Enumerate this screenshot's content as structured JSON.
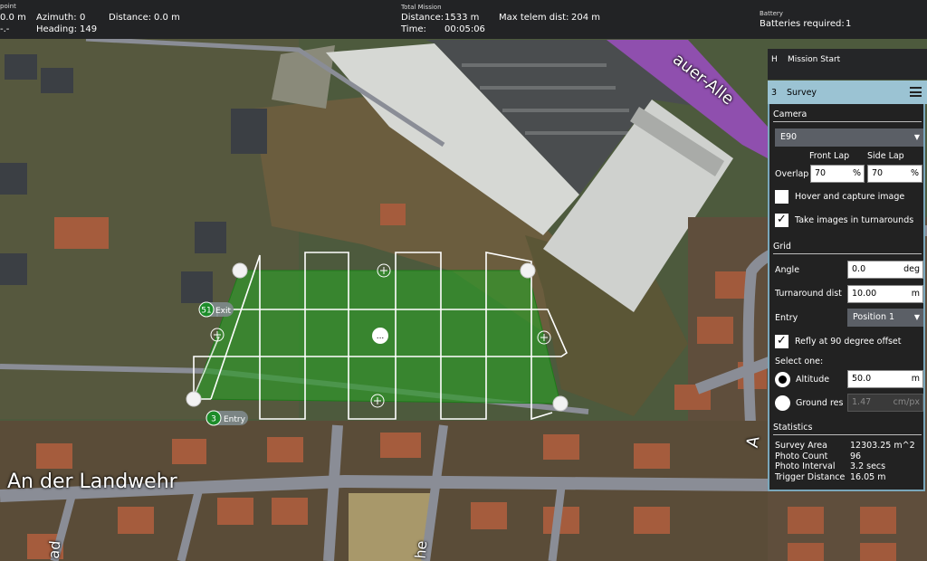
{
  "topbar": {
    "waypoint_header": "point",
    "waypoint_left_value1": "0.0 m",
    "waypoint_left_value2": "-.-",
    "azimuth_label": "Azimuth:",
    "azimuth_value": "0",
    "distance_label": "Distance:",
    "distance_value": "0.0 m",
    "heading_label": "Heading:",
    "heading_value": "149",
    "total_mission_header": "Total Mission",
    "total_distance_label": "Distance:",
    "total_distance_value": "1533 m",
    "time_label": "Time:",
    "time_value": "00:05:06",
    "max_telem_label": "Max telem dist:",
    "max_telem_value": "204 m",
    "battery_header": "Battery",
    "batteries_label": "Batteries required:",
    "batteries_value": "1"
  },
  "map": {
    "street_landwehr": "An der Landwehr",
    "street_top_right": "auer-Alle",
    "street_bottom_right": "A",
    "street_bottom_left": "ad",
    "street_bottom_center": "he",
    "entry_marker": {
      "number": "3",
      "label": "Entry"
    },
    "exit_marker": {
      "number": "51",
      "label": "Exit"
    },
    "center_marker": "..."
  },
  "plan": {
    "mission_start_index": "H",
    "mission_start_label": "Mission Start"
  },
  "survey": {
    "index": "3",
    "title": "Survey",
    "camera_section": "Camera",
    "camera_value": "E90",
    "front_lap_label": "Front Lap",
    "side_lap_label": "Side Lap",
    "overlap_label": "Overlap",
    "front_lap_value": "70",
    "side_lap_value": "70",
    "percent_unit": "%",
    "hover_capture_label": "Hover and capture image",
    "hover_capture_checked": false,
    "turnaround_images_label": "Take images in turnarounds",
    "turnaround_images_checked": true,
    "grid_section": "Grid",
    "angle_label": "Angle",
    "angle_value": "0.0",
    "angle_unit": "deg",
    "turnaround_label": "Turnaround dist",
    "turnaround_value": "10.00",
    "turnaround_unit": "m",
    "entry_label": "Entry",
    "entry_value": "Position 1",
    "refly_label": "Refly at 90 degree offset",
    "refly_checked": true,
    "select_one_label": "Select one:",
    "altitude_label": "Altitude",
    "altitude_value": "50.0",
    "altitude_unit": "m",
    "ground_res_label": "Ground res",
    "ground_res_value": "1.47",
    "ground_res_unit": "cm/px",
    "statistics_section": "Statistics",
    "stats": [
      {
        "label": "Survey Area",
        "value": "12303.25 m^2"
      },
      {
        "label": "Photo Count",
        "value": "96"
      },
      {
        "label": "Photo Interval",
        "value": "3.2 secs"
      },
      {
        "label": "Trigger Distance",
        "value": "16.05 m"
      }
    ]
  },
  "colors": {
    "survey_fill": "#2f9a2a",
    "panel_header": "#9bc3d3",
    "topbar_bg": "#222325",
    "road": "#8a8d96",
    "violet_road": "#8f4fae"
  }
}
